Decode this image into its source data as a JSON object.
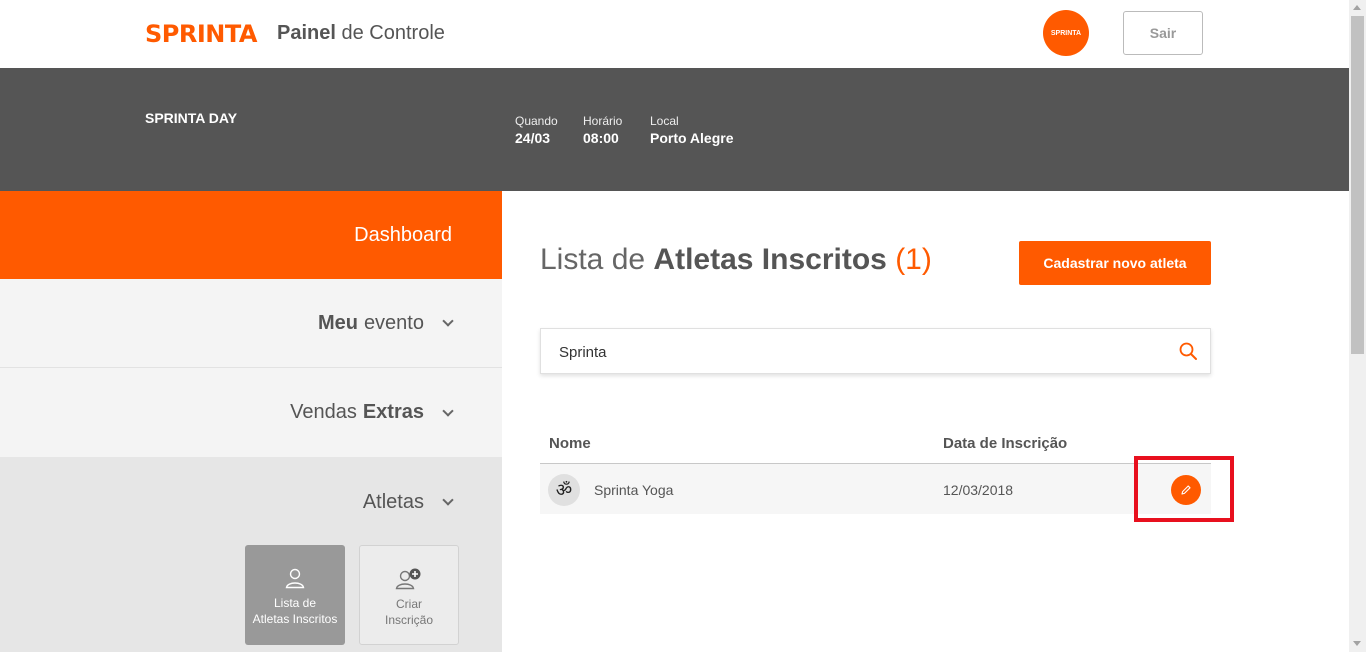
{
  "header": {
    "logo": "SPRINTA",
    "title_bold": "Painel",
    "title_rest": "de Controle",
    "avatar_text": "SPRINTA",
    "logout_label": "Sair"
  },
  "event": {
    "name": "SPRINTA DAY",
    "when_label": "Quando",
    "when_value": "24/03",
    "time_label": "Horário",
    "time_value": "08:00",
    "place_label": "Local",
    "place_value": "Porto Alegre"
  },
  "sidebar": {
    "dashboard": "Dashboard",
    "meu_bold": "Meu",
    "meu_rest": "evento",
    "vendas_pre": "Vendas",
    "vendas_bold": "Extras",
    "atletas": "Atletas",
    "tiles": [
      {
        "line1": "Lista de",
        "line2": "Atletas Inscritos"
      },
      {
        "line1": "Criar",
        "line2": "Inscrição"
      }
    ]
  },
  "main": {
    "title_pre": "Lista de",
    "title_bold": "Atletas Inscritos",
    "count": "(1)",
    "new_button": "Cadastrar novo atleta",
    "search_value": "Sprinta",
    "columns": [
      "Nome",
      "Data de Inscrição"
    ],
    "rows": [
      {
        "name": "Sprinta Yoga",
        "date": "12/03/2018",
        "avatar_glyph": "ॐ"
      }
    ]
  },
  "colors": {
    "brand": "#ff5a00",
    "banner": "#555555",
    "highlight": "#e8101e"
  },
  "icons": [
    "search-icon",
    "pencil-icon",
    "user-icon",
    "user-add-icon",
    "chevron-down-icon"
  ]
}
